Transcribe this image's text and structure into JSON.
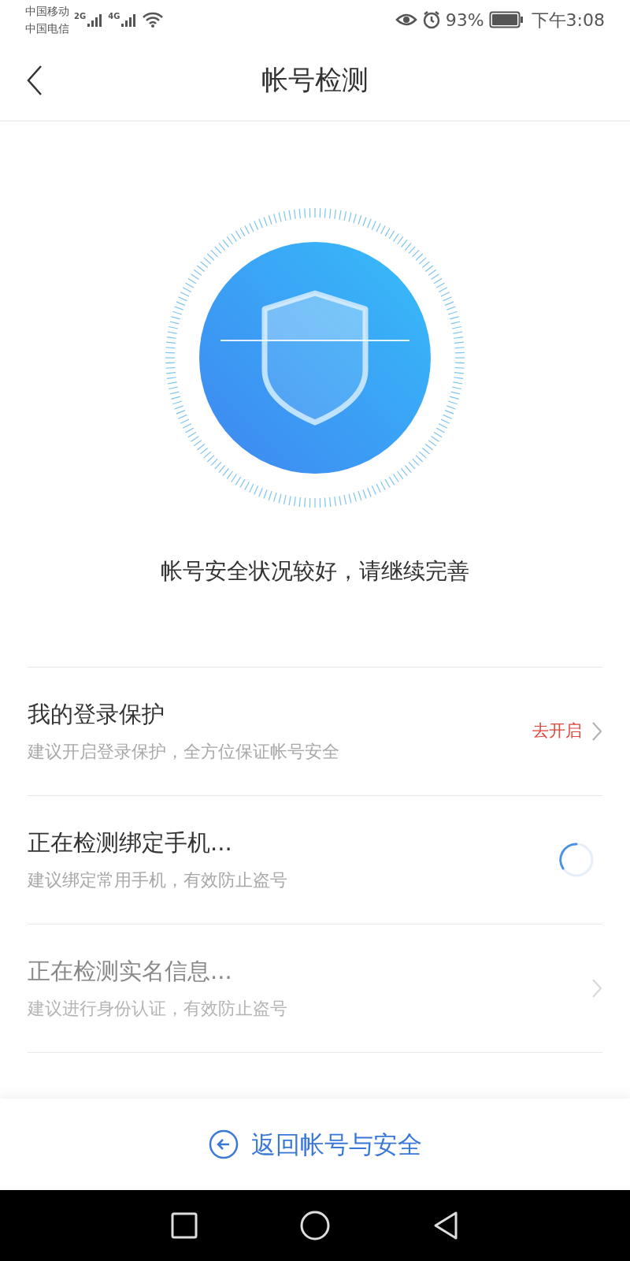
{
  "status_bar": {
    "carriers": [
      "中国移动",
      "中国电信"
    ],
    "signals": [
      "2G",
      "4G"
    ],
    "battery": "93%",
    "time": "下午3:08"
  },
  "header": {
    "title": "帐号检测"
  },
  "summary": "帐号安全状况较好，请继续完善",
  "checks": [
    {
      "kind": "action",
      "title": "我的登录保护",
      "subtitle": "建议开启登录保护，全方位保证帐号安全",
      "action": "去开启"
    },
    {
      "kind": "loading",
      "title": "正在检测绑定手机...",
      "subtitle": "建议绑定常用手机，有效防止盗号"
    },
    {
      "kind": "pending",
      "title": "正在检测实名信息...",
      "subtitle": "建议进行身份认证，有效防止盗号"
    }
  ],
  "bottom_button": {
    "label": "返回帐号与安全"
  }
}
